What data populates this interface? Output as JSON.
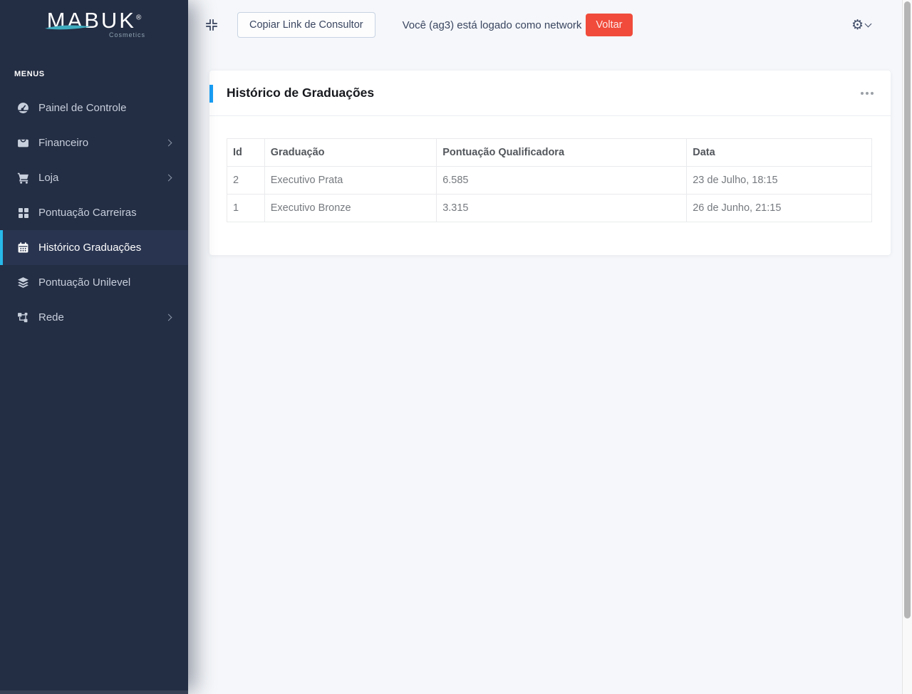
{
  "brand": {
    "name": "MABUK",
    "registered": "®",
    "tagline": "Cosmetics"
  },
  "sidebar": {
    "section_label": "MENUS",
    "items": [
      {
        "label": "Painel de Controle",
        "icon": "speedometer-icon",
        "active": false,
        "has_submenu": false
      },
      {
        "label": "Financeiro",
        "icon": "inbox-icon",
        "active": false,
        "has_submenu": true
      },
      {
        "label": "Loja",
        "icon": "cart-icon",
        "active": false,
        "has_submenu": true
      },
      {
        "label": "Pontuação Carreiras",
        "icon": "grid-icon",
        "active": false,
        "has_submenu": false
      },
      {
        "label": "Histórico Graduações",
        "icon": "calendar-icon",
        "active": true,
        "has_submenu": false
      },
      {
        "label": "Pontuação Unilevel",
        "icon": "layers-icon",
        "active": false,
        "has_submenu": false
      },
      {
        "label": "Rede",
        "icon": "network-icon",
        "active": false,
        "has_submenu": true
      }
    ]
  },
  "topbar": {
    "copy_link_button": "Copiar Link de Consultor",
    "status_text": "Você (ag3) está logado como network",
    "back_button": "Voltar"
  },
  "card": {
    "title": "Histórico de Graduações"
  },
  "table": {
    "columns": [
      "Id",
      "Graduação",
      "Pontuação Qualificadora",
      "Data"
    ],
    "rows": [
      {
        "id": "2",
        "graduacao": "Executivo Prata",
        "pontuacao": "6.585",
        "data": "23 de Julho, 18:15"
      },
      {
        "id": "1",
        "graduacao": "Executivo Bronze",
        "pontuacao": "3.315",
        "data": "26 de Junho, 21:15"
      }
    ]
  },
  "colors": {
    "sidebar_bg": "#232d43",
    "active_item_cyan": "#27b9ea",
    "card_accent_blue": "#199ef5",
    "success_green": "#2eae4c",
    "danger_red": "#f04b3b",
    "logo_swoosh_teal": "#3fadc0"
  }
}
